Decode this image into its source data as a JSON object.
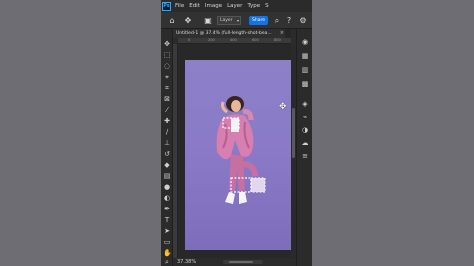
{
  "app": {
    "logo": "Ps",
    "menu": [
      "File",
      "Edit",
      "Image",
      "Layer",
      "Type",
      "S"
    ]
  },
  "options_bar": {
    "layer_select": "Layer",
    "share_label": "Share",
    "icons": [
      "home-icon",
      "move-icon",
      "auto-select-icon",
      "search-icon",
      "help-icon",
      "settings-icon"
    ]
  },
  "document": {
    "tab_title": "Untitled-1 @ 37.4% (full-length-shot-bea...",
    "ruler_ticks": [
      "0",
      "200",
      "400",
      "600",
      "800"
    ],
    "zoom": "37.38%"
  },
  "toolbar": {
    "tools": [
      "move-tool-icon",
      "marquee-tool-icon",
      "lasso-tool-icon",
      "object-select-icon",
      "crop-tool-icon",
      "frame-tool-icon",
      "eyedropper-icon",
      "healing-brush-icon",
      "brush-tool-icon",
      "clone-stamp-icon",
      "history-brush-icon",
      "eraser-tool-icon",
      "gradient-tool-icon",
      "blur-tool-icon",
      "dodge-tool-icon",
      "pen-tool-icon",
      "type-tool-icon",
      "path-select-icon",
      "rectangle-tool-icon",
      "hand-tool-icon",
      "zoom-tool-icon",
      "more-tools-icon",
      "foreground-background-icon",
      "quick-mask-icon",
      "screen-mode-icon"
    ]
  },
  "right_panel": {
    "icons": [
      "color-panel-icon",
      "swatches-icon",
      "gradients-icon",
      "patterns-icon",
      "layers-icon",
      "paths-icon",
      "adjustments-icon",
      "libraries-icon",
      "properties-icon"
    ]
  },
  "colors": {
    "accent": "#1473e6",
    "canvas_bg": "#8a7ac8"
  }
}
